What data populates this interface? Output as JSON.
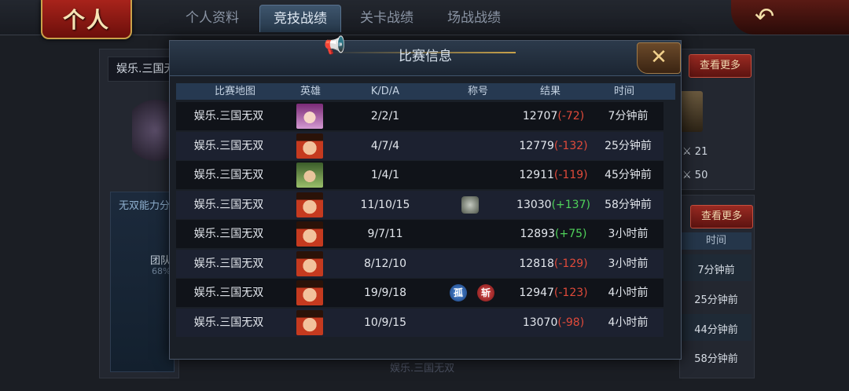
{
  "header": {
    "badge": "个人",
    "tabs": [
      {
        "label": "个人资料",
        "active": false
      },
      {
        "label": "竞技战绩",
        "active": true
      },
      {
        "label": "关卡战绩",
        "active": false
      },
      {
        "label": "场战战绩",
        "active": false
      }
    ],
    "back_icon": "back-arrow-icon"
  },
  "background": {
    "player_name": "娱乐.三国无",
    "skill_title": "无双能力分",
    "skill_label": "团队",
    "skill_pct": "68%",
    "more_label_1": "查看更多",
    "more_label_2": "查看更多",
    "stat_1": "21",
    "stat_2": "50",
    "time_header": "时间",
    "times": [
      "7分钟前",
      "25分钟前",
      "44分钟前",
      "58分钟前"
    ],
    "peek_map": "娱乐.三国无双"
  },
  "modal": {
    "title": "比赛信息",
    "close_icon": "close-x-icon",
    "columns": [
      "比赛地图",
      "英雄",
      "K/D/A",
      "称号",
      "结果",
      "时间"
    ],
    "rows": [
      {
        "map": "娱乐.三国无双",
        "hero": "pink",
        "kda": "2/2/1",
        "titles": [],
        "score": "12707",
        "delta": "(-72)",
        "sign": "neg",
        "time": "7分钟前"
      },
      {
        "map": "娱乐.三国无双",
        "hero": "red",
        "kda": "4/7/4",
        "titles": [],
        "score": "12779",
        "delta": "(-132)",
        "sign": "neg",
        "time": "25分钟前"
      },
      {
        "map": "娱乐.三国无双",
        "hero": "green",
        "kda": "1/4/1",
        "titles": [],
        "score": "12911",
        "delta": "(-119)",
        "sign": "neg",
        "time": "45分钟前"
      },
      {
        "map": "娱乐.三国无双",
        "hero": "red",
        "kda": "11/10/15",
        "titles": [
          "badge"
        ],
        "score": "13030",
        "delta": "(+137)",
        "sign": "pos",
        "time": "58分钟前"
      },
      {
        "map": "娱乐.三国无双",
        "hero": "red",
        "kda": "9/7/11",
        "titles": [],
        "score": "12893",
        "delta": "(+75)",
        "sign": "pos",
        "time": "3小时前"
      },
      {
        "map": "娱乐.三国无双",
        "hero": "red",
        "kda": "8/12/10",
        "titles": [],
        "score": "12818",
        "delta": "(-129)",
        "sign": "neg",
        "time": "3小时前"
      },
      {
        "map": "娱乐.三国无双",
        "hero": "red",
        "kda": "19/9/18",
        "titles": [
          "孤",
          "斩"
        ],
        "score": "12947",
        "delta": "(-123)",
        "sign": "neg",
        "time": "4小时前"
      },
      {
        "map": "娱乐.三国无双",
        "hero": "red",
        "kda": "10/9/15",
        "titles": [],
        "score": "13070",
        "delta": "(-98)",
        "sign": "neg",
        "time": "4小时前"
      }
    ]
  }
}
